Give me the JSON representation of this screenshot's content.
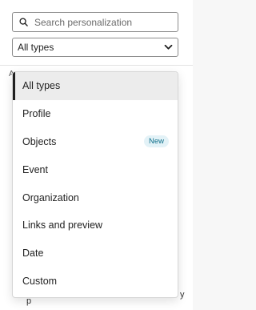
{
  "search": {
    "placeholder": "Search personalization",
    "value": ""
  },
  "type_select": {
    "selected": "All types"
  },
  "background": {
    "left_glyph": "A",
    "bottom_fragment": "p",
    "right_glyph": "y"
  },
  "dropdown": {
    "options": [
      {
        "label": "All types",
        "selected": true,
        "badge": ""
      },
      {
        "label": "Profile",
        "selected": false,
        "badge": ""
      },
      {
        "label": "Objects",
        "selected": false,
        "badge": "New"
      },
      {
        "label": "Event",
        "selected": false,
        "badge": ""
      },
      {
        "label": "Organization",
        "selected": false,
        "badge": ""
      },
      {
        "label": "Links and preview",
        "selected": false,
        "badge": ""
      },
      {
        "label": "Date",
        "selected": false,
        "badge": ""
      },
      {
        "label": "Custom",
        "selected": false,
        "badge": ""
      }
    ]
  },
  "colors": {
    "selected_bg": "#ececec",
    "selected_marker": "#1f1f1f",
    "badge_bg": "#e3f2f7",
    "badge_text": "#0f6f8a"
  }
}
